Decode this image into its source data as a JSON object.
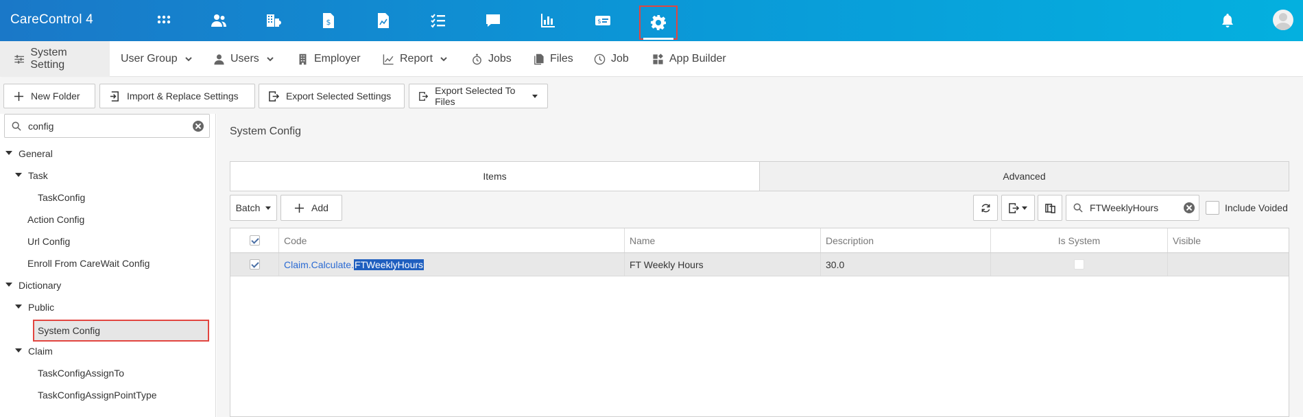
{
  "app": {
    "title": "CareControl 4"
  },
  "topnav": {
    "icons": [
      "apps-grid-icon",
      "people-icon",
      "buildings-icon",
      "invoice-icon",
      "report-file-icon",
      "checklist-icon",
      "chat-icon",
      "bar-chart-icon",
      "id-card-icon",
      "gear-icon"
    ],
    "active": "gear-icon",
    "right_icons": [
      "bell-icon",
      "avatar"
    ]
  },
  "subnav": {
    "system_setting": "System Setting",
    "user_group": "User Group",
    "users": "Users",
    "employer": "Employer",
    "report": "Report",
    "jobs": "Jobs",
    "files": "Files",
    "job": "Job",
    "app_builder": "App Builder"
  },
  "toolbar": {
    "new_folder": "New Folder",
    "import_replace": "Import & Replace Settings",
    "export_selected": "Export Selected Settings",
    "export_to_files": "Export Selected To Files"
  },
  "sidebar": {
    "search_value": "config",
    "tree": [
      {
        "label": "General",
        "expanded": true
      },
      {
        "label": "Task",
        "expanded": true
      },
      {
        "label": "TaskConfig"
      },
      {
        "label": "Action Config"
      },
      {
        "label": "Url Config"
      },
      {
        "label": "Enroll From CareWait Config"
      },
      {
        "label": "Dictionary",
        "expanded": true
      },
      {
        "label": "Public",
        "expanded": true
      },
      {
        "label": "System Config",
        "selected": true
      },
      {
        "label": "Claim",
        "expanded": true
      },
      {
        "label": "TaskConfigAssignTo"
      },
      {
        "label": "TaskConfigAssignPointType"
      }
    ]
  },
  "main": {
    "title": "System Config",
    "tabs": [
      "Items",
      "Advanced"
    ],
    "batch_label": "Batch",
    "add_label": "Add",
    "search_value": "FTWeeklyHours",
    "include_voided": "Include Voided",
    "grid": {
      "columns": [
        "Code",
        "Name",
        "Description",
        "Is System",
        "Visible"
      ],
      "rows": [
        {
          "code_prefix": "Claim.Calculate.",
          "code_match": "FTWeeklyHours",
          "name": "FT Weekly Hours",
          "description": "30.0",
          "is_system": false,
          "visible": "",
          "checked": true
        }
      ]
    }
  },
  "colors": {
    "accent_gradient_start": "#1a78c8",
    "accent_gradient_end": "#04b0df",
    "highlight_red": "#e2453f",
    "link_blue": "#2a6ad3"
  }
}
